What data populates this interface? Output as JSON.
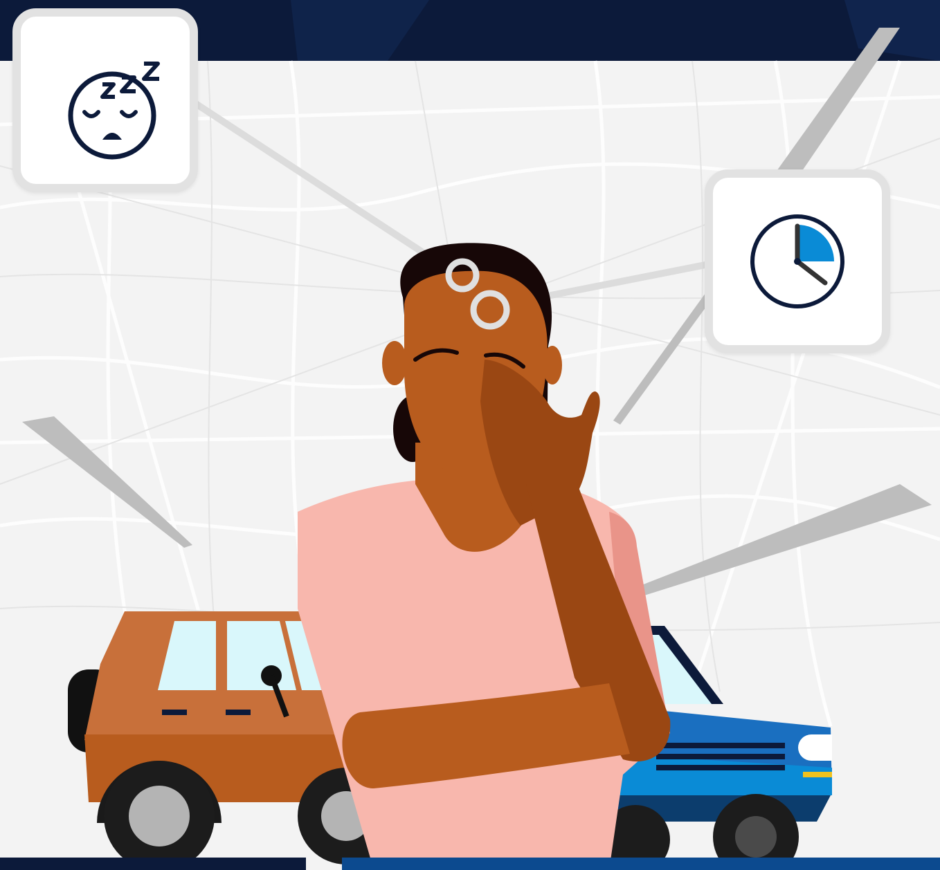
{
  "illustration": {
    "icons": [
      "sleeping-face-icon",
      "clock-icon"
    ],
    "colors": {
      "navy": "#0c1a3a",
      "accent_blue": "#0a8bd6",
      "skin": "#b85c1e",
      "skin_shadow": "#9a4713",
      "shirt": "#f8b7ad",
      "hair": "#170707",
      "brown_car": "#c8703a",
      "blue_car": "#1a6fc0",
      "pointer_grey": "#bdbdbd",
      "map_background": "#f3f3f3"
    }
  }
}
